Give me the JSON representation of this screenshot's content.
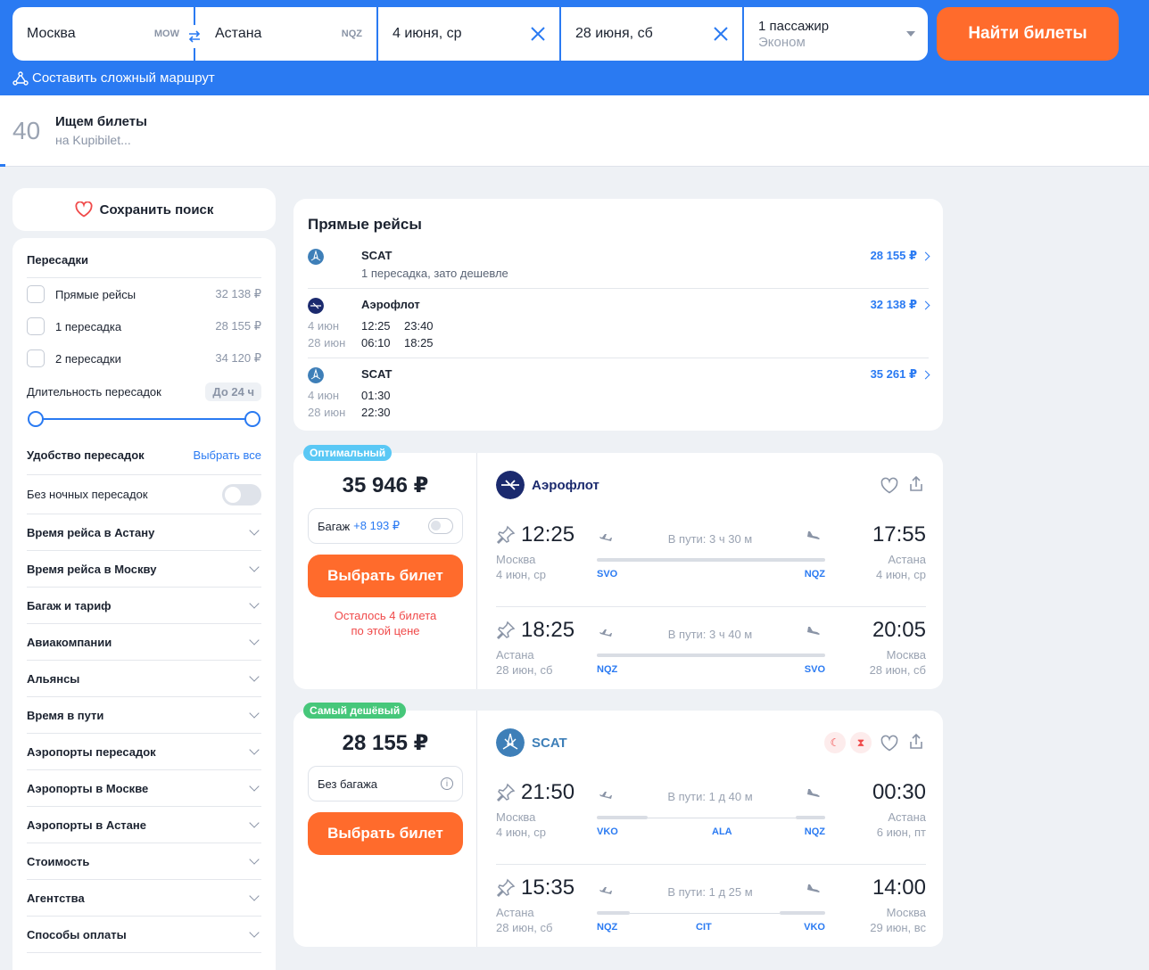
{
  "search": {
    "from_city": "Москва",
    "from_code": "MOW",
    "to_city": "Астана",
    "to_code": "NQZ",
    "depart_date": "4 июня, ср",
    "return_date": "28 июня, сб",
    "passengers": "1 пассажир",
    "cabin": "Эконом",
    "find_label": "Найти билеты",
    "complex_route": "Составить сложный маршрут"
  },
  "progress": {
    "count": "40",
    "title": "Ищем билеты",
    "subtitle": "на Kupibilet...",
    "percent": 0.005
  },
  "sidebar": {
    "save_search": "Сохранить поиск",
    "transfers_heading": "Пересадки",
    "stops": [
      {
        "label": "Прямые рейсы",
        "price": "32 138 ₽"
      },
      {
        "label": "1 пересадка",
        "price": "28 155 ₽"
      },
      {
        "label": "2 пересадки",
        "price": "34 120 ₽"
      }
    ],
    "duration_label": "Длительность пересадок",
    "duration_value": "До 24 ч",
    "convenience_label": "Удобство пересадок",
    "select_all": "Выбрать все",
    "no_night": "Без ночных пересадок",
    "accordions": [
      "Время рейса в Астану",
      "Время рейса в Москву",
      "Багаж и тариф",
      "Авиакомпании",
      "Альянсы",
      "Время в пути",
      "Аэропорты пересадок",
      "Аэропорты в Москве",
      "Аэропорты в Астане",
      "Стоимость",
      "Агентства",
      "Способы оплаты"
    ]
  },
  "direct": {
    "title": "Прямые рейсы",
    "rows": [
      {
        "airline": "SCAT",
        "note": "1 пересадка, зато дешевле",
        "price": "28 155 ₽"
      },
      {
        "airline": "Аэрофлот",
        "price": "32 138 ₽",
        "out_date": "4 июн",
        "out_dep": "12:25",
        "out_arr": "23:40",
        "ret_date": "28 июн",
        "ret_dep": "06:10",
        "ret_arr": "18:25"
      },
      {
        "airline": "SCAT",
        "price": "35 261 ₽",
        "out_date": "4 июн",
        "out_dep": "01:30",
        "ret_date": "28 июн",
        "ret_dep": "22:30"
      }
    ]
  },
  "offers": [
    {
      "badge": "Оптимальный",
      "price": "35 946 ₽",
      "baggage_label": "Багаж",
      "baggage_extra": "+8 193 ₽",
      "button": "Выбрать билет",
      "warning_line1": "Осталось 4 билета",
      "warning_line2": "по этой цене",
      "airline": "Аэрофлот",
      "out": {
        "dep_time": "12:25",
        "dep_city": "Москва",
        "dep_date": "4 июн, ср",
        "duration": "В пути: 3 ч 30 м",
        "arr_time": "17:55",
        "arr_city": "Астана",
        "arr_date": "4 июн, ср",
        "from_code": "SVO",
        "to_code": "NQZ"
      },
      "ret": {
        "dep_time": "18:25",
        "dep_city": "Астана",
        "dep_date": "28 июн, сб",
        "duration": "В пути: 3 ч 40 м",
        "arr_time": "20:05",
        "arr_city": "Москва",
        "arr_date": "28 июн, сб",
        "from_code": "NQZ",
        "to_code": "SVO"
      }
    },
    {
      "badge": "Самый дешёвый",
      "price": "28 155 ₽",
      "baggage_label": "Без багажа",
      "button": "Выбрать билет",
      "airline": "SCAT",
      "out": {
        "dep_time": "21:50",
        "dep_city": "Москва",
        "dep_date": "4 июн, ср",
        "duration": "В пути: 1 д 40 м",
        "arr_time": "00:30",
        "arr_city": "Астана",
        "arr_date": "6 июн, пт",
        "from_code": "VKO",
        "via_code": "ALA",
        "to_code": "NQZ"
      },
      "ret": {
        "dep_time": "15:35",
        "dep_city": "Астана",
        "dep_date": "28 июн, сб",
        "duration": "В пути: 1 д 25 м",
        "arr_time": "14:00",
        "arr_city": "Москва",
        "arr_date": "29 июн, вс",
        "from_code": "NQZ",
        "via_code": "CIT",
        "to_code": "VKO"
      }
    }
  ],
  "colors": {
    "brand_blue": "#2a7af2",
    "accent_orange": "#ff6b2c",
    "badge_optimal": "#5ac8f5",
    "badge_cheapest": "#46c77a",
    "aeroflot": "#1b2a6e",
    "scat": "#3e7fb8"
  },
  "icons": [
    "swap-icon",
    "clear-icon",
    "caret-down-icon",
    "route-icon",
    "heart-icon",
    "chevron-right-icon",
    "chevron-down-icon",
    "pin-icon",
    "plane-takeoff-icon",
    "plane-landing-icon",
    "share-icon",
    "moon-icon",
    "hourglass-icon",
    "info-icon"
  ]
}
